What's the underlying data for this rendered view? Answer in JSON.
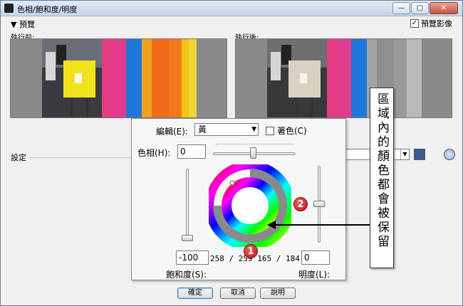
{
  "window": {
    "title": "色相/飽和度/明度",
    "buttons": {
      "minimize": "—",
      "maximize": "□",
      "close": "✕"
    }
  },
  "preview": {
    "section_label": "預覽",
    "checkbox_label": "預覽影像",
    "checkbox_checked": true,
    "before_label": "執行前:",
    "after_label": "執行後:"
  },
  "settings": {
    "label": "設定",
    "preset_value": ""
  },
  "popup": {
    "edit_label": "編輯(E):",
    "edit_value": "黃",
    "colorize_label": "著色(C)",
    "hue_label": "色相(H):",
    "hue_value": "0",
    "saturation_value": "-100",
    "saturation_label": "飽和度(S):",
    "lightness_value": "0",
    "lightness_label": "明度(L):",
    "readout": "258 / 259 165 / 184",
    "hue_slider_fraction": 0.5,
    "saturation_slider_fraction": 0.0,
    "lightness_slider_fraction": 0.5
  },
  "annotations": {
    "badge1": "1",
    "badge2": "2",
    "callout_text": "區域內的顏色都會被保留",
    "badge_color": "#c62020"
  },
  "footer": {
    "ok": "確定",
    "cancel": "取消",
    "help": "說明"
  }
}
